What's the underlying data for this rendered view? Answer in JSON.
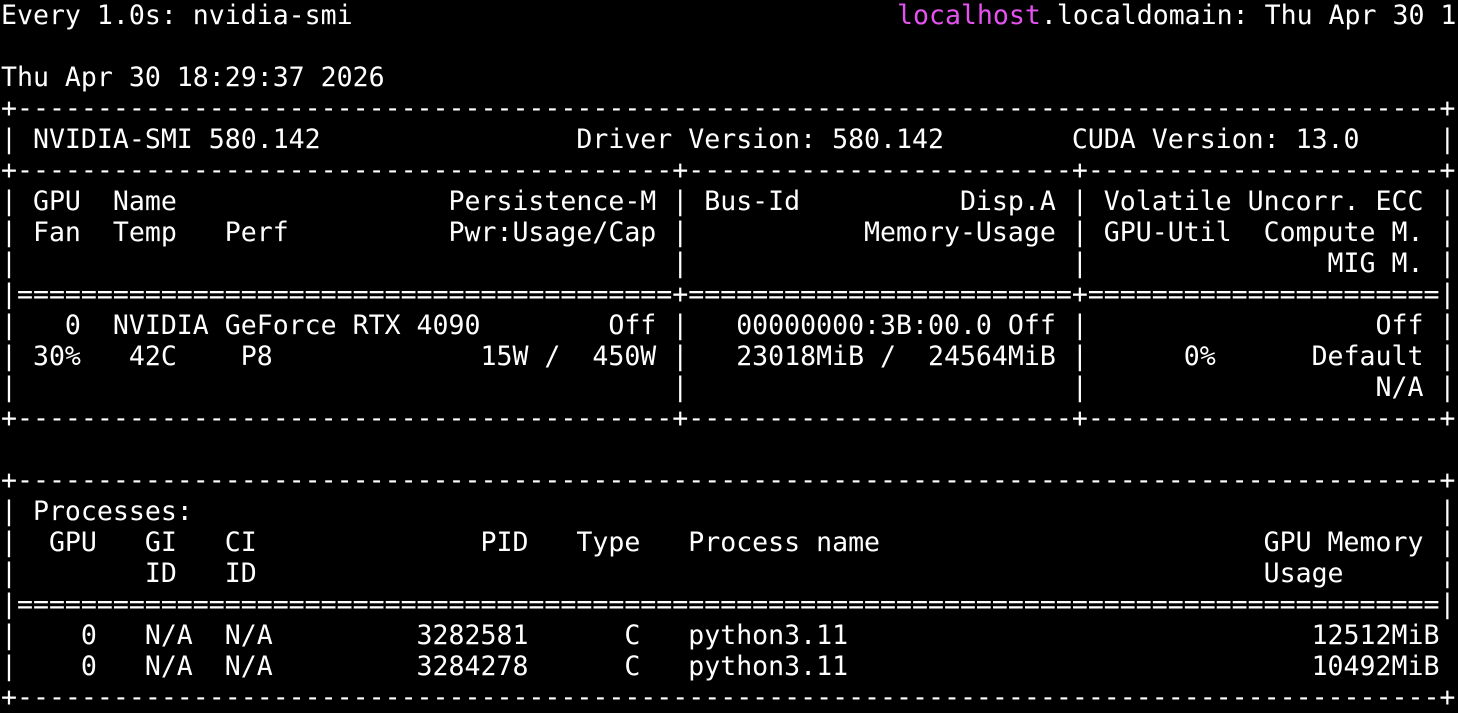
{
  "header": {
    "watch_command": "Every 1.0s: nvidia-smi",
    "host_highlight": "localhost",
    "host_rest": ".localdomain: Thu Apr 30 1"
  },
  "timestamp": "Thu Apr 30 18:29:37 2026",
  "colors": {
    "background": "#000000",
    "text": "#ffffff",
    "hostname_highlight": "#e552ef"
  },
  "smi_lines": [
    "+-----------------------------------------------------------------------------------------+",
    "| NVIDIA-SMI 580.142                Driver Version: 580.142        CUDA Version: 13.0     |",
    "+-----------------------------------------+------------------------+----------------------+",
    "| GPU  Name                 Persistence-M | Bus-Id          Disp.A | Volatile Uncorr. ECC |",
    "| Fan  Temp   Perf          Pwr:Usage/Cap |           Memory-Usage | GPU-Util  Compute M. |",
    "|                                         |                        |               MIG M. |",
    "|=========================================+========================+======================|",
    "|   0  NVIDIA GeForce RTX 4090        Off |   00000000:3B:00.0 Off |                  Off |",
    "| 30%   42C    P8             15W /  450W |   23018MiB /  24564MiB |      0%      Default |",
    "|                                         |                        |                  N/A |",
    "+-----------------------------------------+------------------------+----------------------+",
    "",
    "+-----------------------------------------------------------------------------------------+",
    "| Processes:                                                                              |",
    "|  GPU   GI   CI              PID   Type   Process name                        GPU Memory |",
    "|        ID   ID                                                               Usage      |",
    "|=========================================================================================|",
    "|    0   N/A  N/A         3282581      C   python3.11                             12512MiB |",
    "|    0   N/A  N/A         3284278      C   python3.11                             10492MiB |",
    "+-----------------------------------------------------------------------------------------+"
  ]
}
